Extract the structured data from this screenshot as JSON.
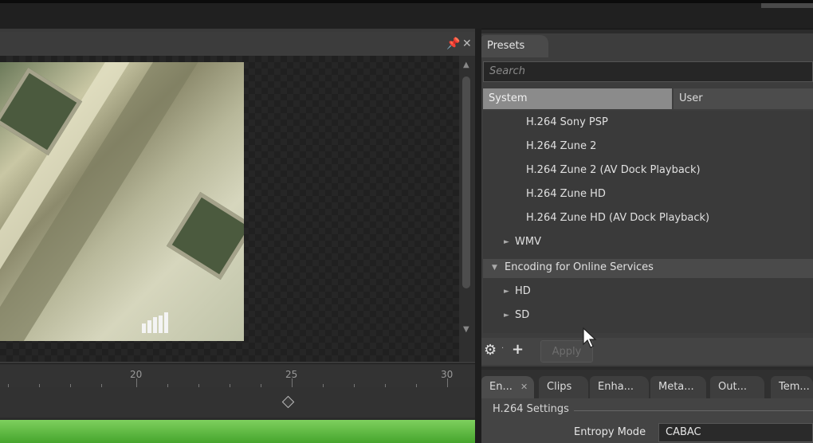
{
  "presets_panel": {
    "tab_label": "Presets",
    "search_placeholder": "Search",
    "segments": {
      "system": "System",
      "user": "User"
    },
    "items": [
      "H.264 Sony PSP",
      "H.264 Zune 2",
      "H.264 Zune 2 (AV Dock Playback)",
      "H.264 Zune HD",
      "H.264 Zune HD (AV Dock Playback)"
    ],
    "wmv_group": "WMV",
    "online_section": "Encoding for Online Services",
    "online_children": [
      "HD",
      "SD"
    ],
    "apply_label": "Apply"
  },
  "timeline": {
    "tick_labels": [
      "20",
      "25",
      "30"
    ]
  },
  "settings_tabs": [
    "En...",
    "Clips",
    "Enha...",
    "Meta...",
    "Out...",
    "Tem..."
  ],
  "settings": {
    "group_label": "H.264 Settings",
    "entropy_label": "Entropy Mode",
    "entropy_value": "CABAC"
  },
  "colors": {
    "progress_green": "#5bb83c",
    "selected_segment": "#8b8b8b",
    "panel_bg": "#3d3d3d"
  },
  "icons": [
    "pin-icon",
    "close-icon",
    "gear-icon",
    "add-icon",
    "keyframe-icon",
    "signal-icon",
    "cursor-icon"
  ]
}
